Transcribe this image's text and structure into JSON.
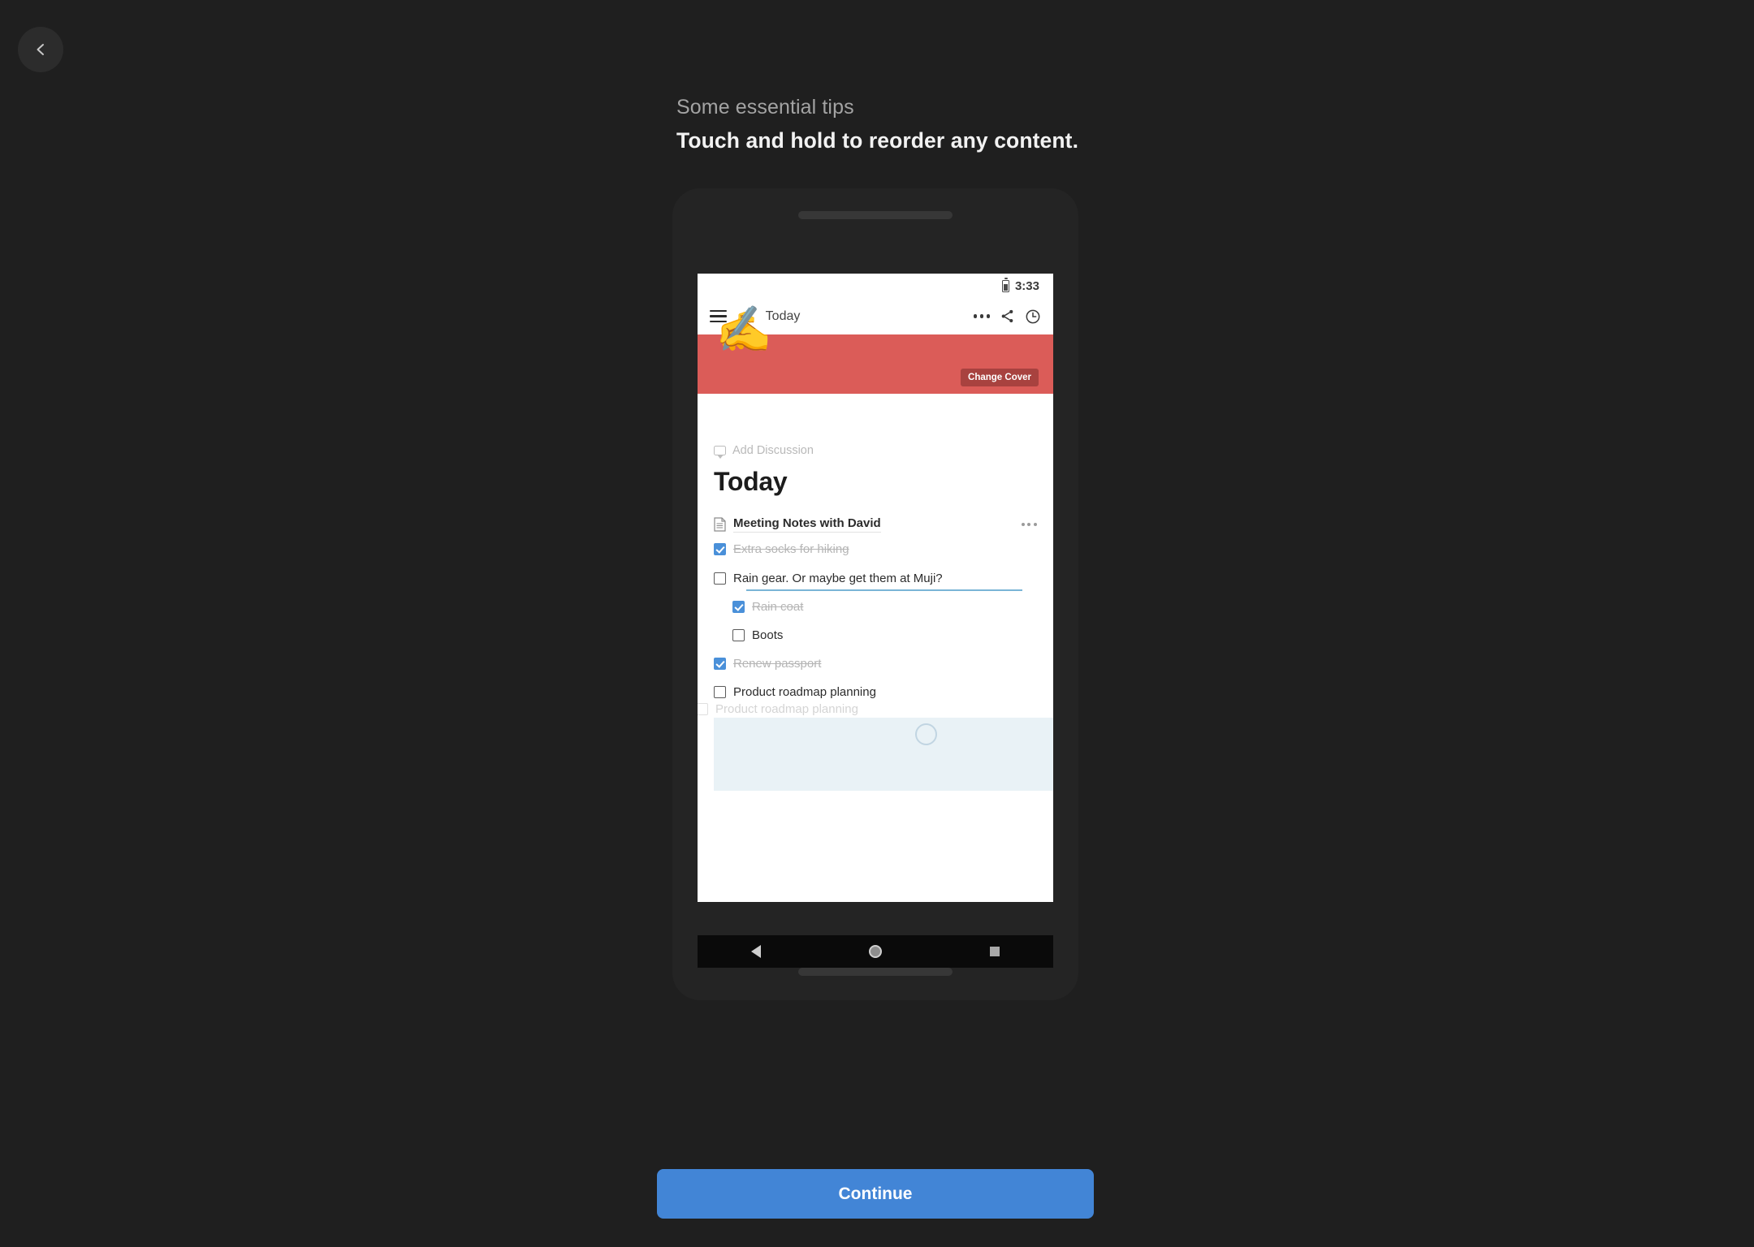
{
  "nav": {
    "back_icon": "chevron-left-icon"
  },
  "header": {
    "eyebrow": "Some essential tips",
    "title": "Touch and hold to reorder any content."
  },
  "phone": {
    "status_bar": {
      "battery_icon": "battery-icon",
      "time": "3:33"
    },
    "app_bar": {
      "menu_icon": "hamburger-menu-icon",
      "app_emoji": "✍️",
      "title": "Today",
      "overflow_icon": "more-options-icon",
      "share_icon": "share-icon",
      "history_icon": "clock-history-icon"
    },
    "cover": {
      "color": "#db5c58",
      "change_cover_label": "Change Cover",
      "doc_emoji": "✍️"
    },
    "document": {
      "add_discussion_label": "Add Discussion",
      "title": "Today",
      "note": {
        "icon": "document-icon",
        "label": "Meeting Notes with David",
        "overflow_icon": "more-options-icon"
      },
      "items": [
        {
          "label": "Extra socks for hiking",
          "checked": true,
          "indent": 0
        },
        {
          "label": "Rain gear. Or maybe get them at Muji?",
          "checked": false,
          "indent": 0
        },
        {
          "label": "Rain coat",
          "checked": true,
          "indent": 1
        },
        {
          "label": "Boots",
          "checked": false,
          "indent": 1
        },
        {
          "label": "Renew passport",
          "checked": true,
          "indent": 0
        },
        {
          "label": "Product roadmap planning",
          "checked": false,
          "indent": 0
        }
      ],
      "dragged_item": {
        "label": "Product roadmap planning",
        "checked": false
      }
    },
    "nav_bar": {
      "back_icon": "android-back-icon",
      "home_icon": "android-home-icon",
      "recents_icon": "android-recents-icon"
    }
  },
  "footer": {
    "continue_label": "Continue"
  },
  "colors": {
    "background": "#1f1f1f",
    "accent": "#4285d6",
    "cover": "#db5c58",
    "checkbox": "#4a90d9",
    "dropzone": "#e9f2f6",
    "drop_line": "#7ab5d6"
  }
}
